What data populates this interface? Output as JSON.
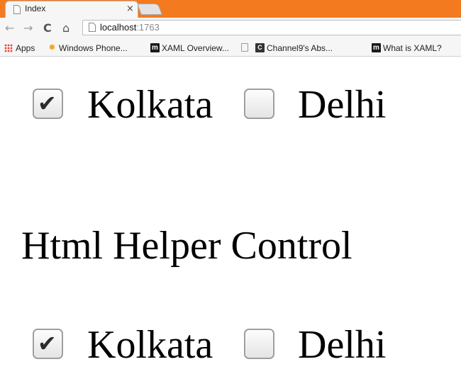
{
  "browser": {
    "tab": {
      "title": "Index",
      "close": "×"
    },
    "nav": {
      "back": "←",
      "forward": "→",
      "reload": "C",
      "home": "⌂"
    },
    "address": {
      "host": "localhost",
      "port": ":1763"
    },
    "bookmarks": [
      {
        "label": "Apps",
        "icon": "apps-grid-icon"
      },
      {
        "label": "Windows Phone...",
        "icon": "windows-phone-icon"
      },
      {
        "label": "XAML Overview...",
        "icon": "m-icon"
      },
      {
        "label": "",
        "icon": "document-icon"
      },
      {
        "label": "Channel9's Abs...",
        "icon": "channel9-icon"
      },
      {
        "label": "What is XAML?",
        "icon": "m-icon"
      }
    ]
  },
  "page": {
    "top_checkboxes": [
      {
        "label": "Kolkata",
        "checked": true
      },
      {
        "label": "Delhi",
        "checked": false
      }
    ],
    "heading": "Html Helper Control",
    "helper_checkboxes": [
      {
        "label": "Kolkata",
        "checked": true
      },
      {
        "label": "Delhi",
        "checked": false
      }
    ]
  },
  "colors": {
    "tabstrip": "#f47a20",
    "chrome": "#f6f6f6"
  }
}
